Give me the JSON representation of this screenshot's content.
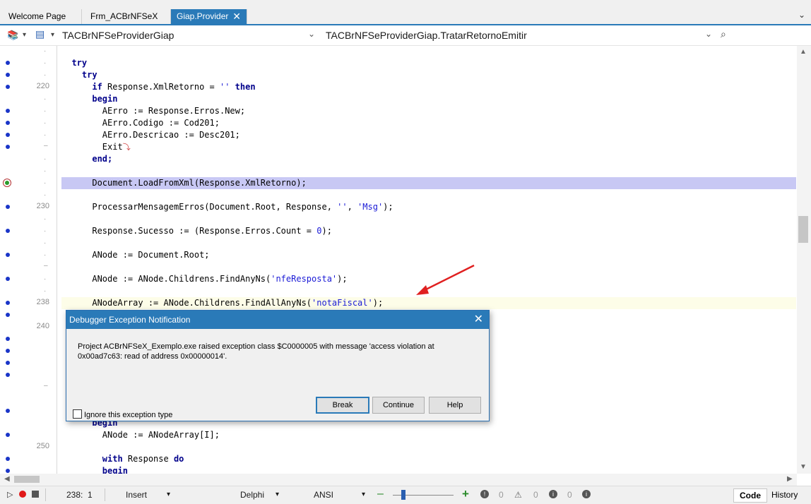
{
  "tabs": [
    {
      "label": "Welcome Page",
      "active": false
    },
    {
      "label": "Frm_ACBrNFSeX",
      "active": false
    },
    {
      "label": "Giap.Provider",
      "active": true
    }
  ],
  "nav": {
    "class_combo": "TACBrNFSeProviderGiap",
    "method_combo": "TACBrNFSeProviderGiap.TratarRetornoEmitir"
  },
  "gutter_numbers": {
    "n220": "220",
    "n230": "230",
    "n238": "238",
    "n240": "240",
    "n250": "250"
  },
  "code": {
    "l1": "try",
    "l2": "try",
    "l3_kw1": "if",
    "l3_mid": " Response.XmlRetorno = ",
    "l3_str": "''",
    "l3_kw2": " then",
    "l4": "begin",
    "l5": "AErro := Response.Erros.New;",
    "l6": "AErro.Codigo := Cod201;",
    "l7": "AErro.Descricao := Desc201;",
    "l8": "Exit",
    "l9": "end;",
    "l10": "Document.LoadFromXml(Response.XmlRetorno);",
    "l11_a": "ProcessarMensagemErros(Document.Root, Response, ",
    "l11_s1": "''",
    "l11_b": ", ",
    "l11_s2": "'Msg'",
    "l11_c": ");",
    "l12_a": "Response.Sucesso := (Response.Erros.Count = ",
    "l12_n": "0",
    "l12_c": ");",
    "l13": "ANode := Document.Root;",
    "l14_a": "ANode := ANode.Childrens.FindAnyNs(",
    "l14_s": "'nfeResposta'",
    "l14_c": ");",
    "l15_a": "ANodeArray := ANode.Childrens.FindAllAnyNs(",
    "l15_s": "'notaFiscal'",
    "l15_c": ");",
    "l16": "begin",
    "l17": "ANode := ANodeArray[I];",
    "l18_kw": "with",
    "l18_mid": " Response ",
    "l18_kw2": "do",
    "l19": "begin"
  },
  "dialog": {
    "title": "Debugger Exception Notification",
    "message": "Project ACBrNFSeX_Exemplo.exe raised exception class $C0000005 with message 'access violation at 0x00ad7c63: read of address 0x00000014'.",
    "checkbox_label": "Ignore this exception type",
    "break_label": "Break",
    "continue_label": "Continue",
    "help_label": "Help"
  },
  "status": {
    "position": "238:  1",
    "mode": "Insert",
    "keymap": "Delphi",
    "encoding": "ANSI",
    "err_count": "0",
    "warn_count": "0",
    "hint_count": "0",
    "code_tab": "Code",
    "history_tab": "History"
  }
}
